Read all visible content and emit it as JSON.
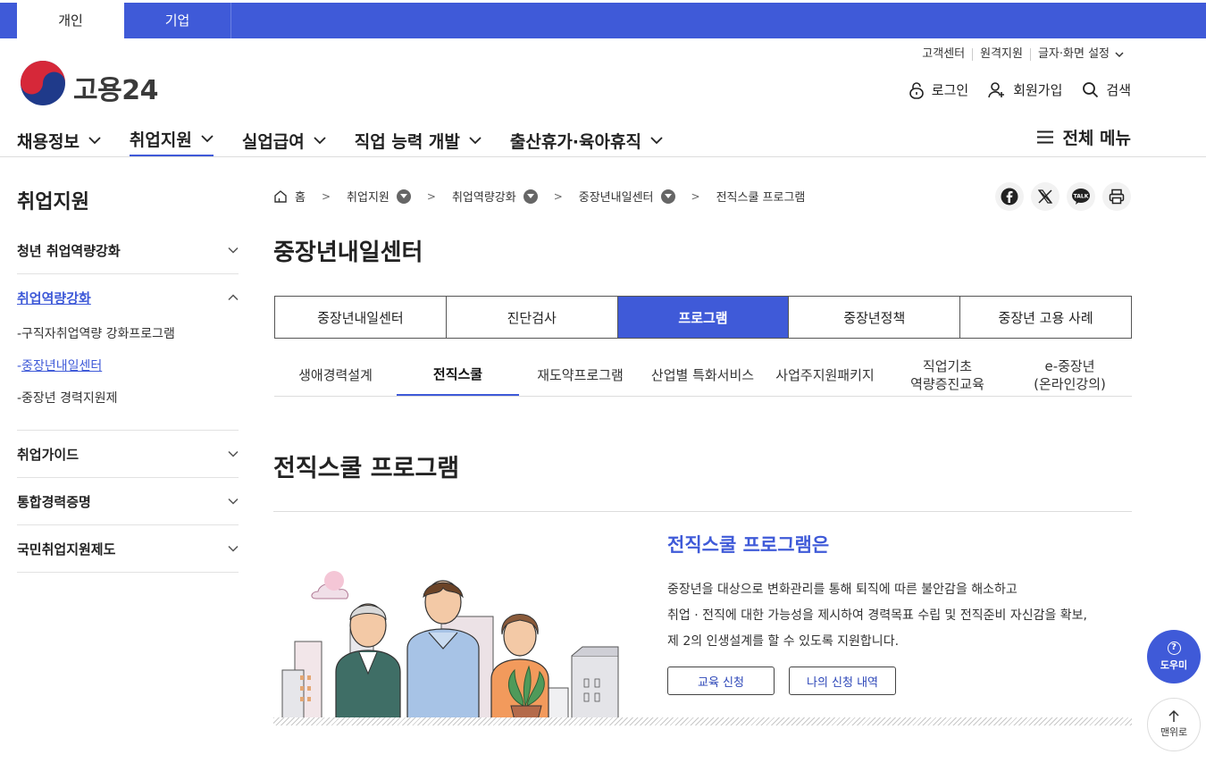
{
  "audience_tabs": [
    "개인",
    "기업"
  ],
  "logo": {
    "text": "고용24"
  },
  "util_links": [
    "고객센터",
    "원격지원",
    "글자·화면 설정"
  ],
  "user_links": {
    "login": "로그인",
    "join": "회원가입",
    "search": "검색"
  },
  "gnb": [
    "채용정보",
    "취업지원",
    "실업급여",
    "직업 능력 개발",
    "출산휴가·육아휴직"
  ],
  "all_menu": "전체 메뉴",
  "lnb": {
    "title": "취업지원",
    "groups": [
      {
        "label": "청년 취업역량강화"
      },
      {
        "label": "취업역량강화",
        "subs": [
          "-구직자취업역량 강화프로그램",
          "-",
          "중장년내일센터",
          "-중장년 경력지원제"
        ]
      },
      {
        "label": "취업가이드"
      },
      {
        "label": "통합경력증명"
      },
      {
        "label": "국민취업지원제도"
      }
    ]
  },
  "breadcrumb": [
    "홈",
    "취업지원",
    "취업역량강화",
    "중장년내일센터",
    "전직스쿨 프로그램"
  ],
  "page_title": "중장년내일센터",
  "tabs1": [
    "중장년내일센터",
    "진단검사",
    "프로그램",
    "중장년정책",
    "중장년 고용 사례"
  ],
  "tabs2": [
    "생애경력설계",
    "전직스쿨",
    "재도약프로그램",
    "산업별 특화서비스",
    "사업주지원패키지",
    "직업기초\n역량증진교육",
    "e-중장년\n(온라인강의)"
  ],
  "section_title": "전직스쿨 프로그램",
  "intro": {
    "title": "전직스쿨 프로그램은",
    "lines": [
      "중장년을 대상으로 변화관리를 통해 퇴직에 따른 불안감을 해소하고",
      "취업 · 전직에 대한 가능성을 제시하여 경력목표 수립 및 전직준비 자신감을 확보,",
      "제 2의 인생설계를 할 수 있도록 지원합니다."
    ],
    "buttons": [
      "교육 신청",
      "나의 신청 내역"
    ]
  },
  "floating": {
    "help": "도우미",
    "top": "맨위로"
  },
  "colors": {
    "accent": "#3f5ad8"
  }
}
